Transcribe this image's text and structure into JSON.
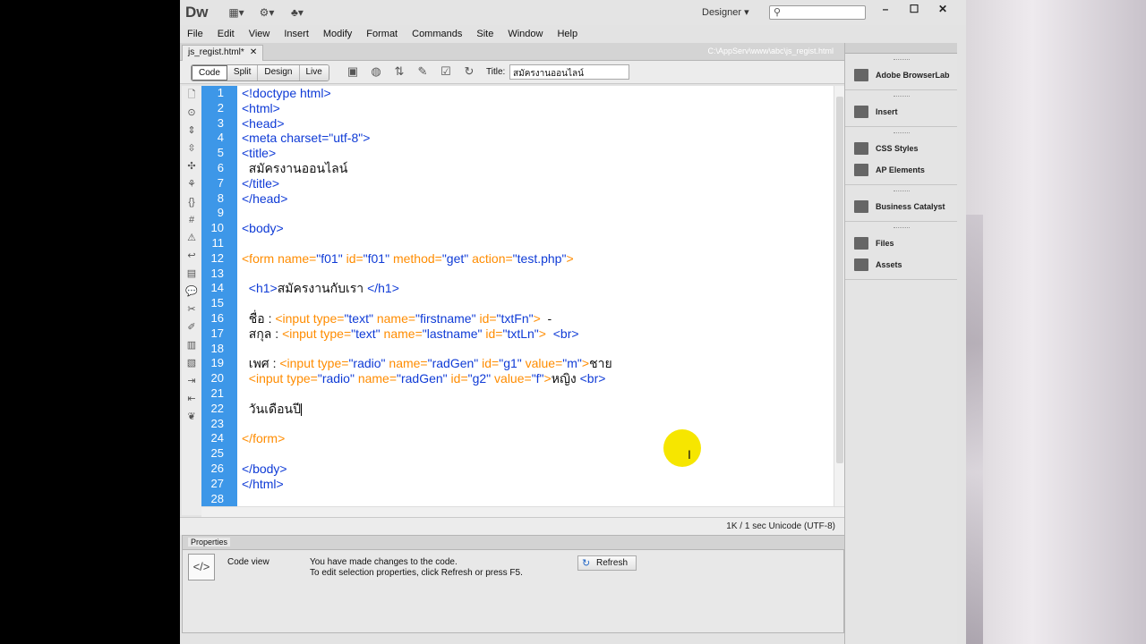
{
  "app": {
    "logo": "Dw",
    "workspace": "Designer",
    "window_buttons": [
      "–",
      "☐",
      "✕"
    ]
  },
  "menu": [
    "File",
    "Edit",
    "View",
    "Insert",
    "Modify",
    "Format",
    "Commands",
    "Site",
    "Window",
    "Help"
  ],
  "document": {
    "tab_name": "js_regist.html*",
    "path": "C:\\AppServ\\www\\abc\\js_regist.html"
  },
  "view_buttons": [
    "Code",
    "Split",
    "Design",
    "Live"
  ],
  "title_label": "Title:",
  "title_value": "สมัครงานออนไลน์",
  "code_lines": [
    [
      {
        "t": "<!doctype html>",
        "c": "tag"
      }
    ],
    [
      {
        "t": "<html>",
        "c": "tag"
      }
    ],
    [
      {
        "t": "<head>",
        "c": "tag"
      }
    ],
    [
      {
        "t": "<meta charset=\"utf-8\">",
        "c": "tag"
      }
    ],
    [
      {
        "t": "<title>",
        "c": "tag"
      }
    ],
    [
      {
        "t": "  สมัครงานออนไลน์",
        "c": "txt"
      }
    ],
    [
      {
        "t": "</title>",
        "c": "tag"
      }
    ],
    [
      {
        "t": "</head>",
        "c": "tag"
      }
    ],
    [],
    [
      {
        "t": "<body>",
        "c": "tag"
      }
    ],
    [],
    [
      {
        "t": "<form ",
        "c": "form"
      },
      {
        "t": "name=",
        "c": "attr"
      },
      {
        "t": "\"f01\" ",
        "c": "val"
      },
      {
        "t": "id=",
        "c": "attr"
      },
      {
        "t": "\"f01\" ",
        "c": "val"
      },
      {
        "t": "method=",
        "c": "attr"
      },
      {
        "t": "\"get\" ",
        "c": "val"
      },
      {
        "t": "action=",
        "c": "attr"
      },
      {
        "t": "\"test.php\"",
        "c": "val"
      },
      {
        "t": ">",
        "c": "form"
      }
    ],
    [],
    [
      {
        "t": "  <h1>",
        "c": "tag"
      },
      {
        "t": "สมัครงานกับเรา ",
        "c": "txt"
      },
      {
        "t": "</h1>",
        "c": "tag"
      }
    ],
    [],
    [
      {
        "t": "  ชื่อ : ",
        "c": "txt"
      },
      {
        "t": "<input ",
        "c": "form"
      },
      {
        "t": "type=",
        "c": "attr"
      },
      {
        "t": "\"text\" ",
        "c": "val"
      },
      {
        "t": "name=",
        "c": "attr"
      },
      {
        "t": "\"firstname\" ",
        "c": "val"
      },
      {
        "t": "id=",
        "c": "attr"
      },
      {
        "t": "\"txtFn\"",
        "c": "val"
      },
      {
        "t": "> ",
        "c": "form"
      },
      {
        "t": " -",
        "c": "txt"
      }
    ],
    [
      {
        "t": "  สกุล : ",
        "c": "txt"
      },
      {
        "t": "<input ",
        "c": "form"
      },
      {
        "t": "type=",
        "c": "attr"
      },
      {
        "t": "\"text\" ",
        "c": "val"
      },
      {
        "t": "name=",
        "c": "attr"
      },
      {
        "t": "\"lastname\" ",
        "c": "val"
      },
      {
        "t": "id=",
        "c": "attr"
      },
      {
        "t": "\"txtLn\"",
        "c": "val"
      },
      {
        "t": "> ",
        "c": "form"
      },
      {
        "t": " <br>",
        "c": "tag"
      }
    ],
    [],
    [
      {
        "t": "  เพศ : ",
        "c": "txt"
      },
      {
        "t": "<input ",
        "c": "form"
      },
      {
        "t": "type=",
        "c": "attr"
      },
      {
        "t": "\"radio\" ",
        "c": "val"
      },
      {
        "t": "name=",
        "c": "attr"
      },
      {
        "t": "\"radGen\" ",
        "c": "val"
      },
      {
        "t": "id=",
        "c": "attr"
      },
      {
        "t": "\"g1\" ",
        "c": "val"
      },
      {
        "t": "value=",
        "c": "attr"
      },
      {
        "t": "\"m\"",
        "c": "val"
      },
      {
        "t": ">",
        "c": "form"
      },
      {
        "t": "ชาย",
        "c": "txt"
      }
    ],
    [
      {
        "t": "  <input ",
        "c": "form"
      },
      {
        "t": "type=",
        "c": "attr"
      },
      {
        "t": "\"radio\" ",
        "c": "val"
      },
      {
        "t": "name=",
        "c": "attr"
      },
      {
        "t": "\"radGen\" ",
        "c": "val"
      },
      {
        "t": "id=",
        "c": "attr"
      },
      {
        "t": "\"g2\" ",
        "c": "val"
      },
      {
        "t": "value=",
        "c": "attr"
      },
      {
        "t": "\"f\"",
        "c": "val"
      },
      {
        "t": ">",
        "c": "form"
      },
      {
        "t": "หญิง ",
        "c": "txt"
      },
      {
        "t": "<br>",
        "c": "tag"
      }
    ],
    [],
    [
      {
        "t": "  วันเดือนปี",
        "c": "txt"
      }
    ],
    [],
    [
      {
        "t": "</form>",
        "c": "form"
      }
    ],
    [],
    [
      {
        "t": "</body>",
        "c": "tag"
      }
    ],
    [
      {
        "t": "</html>",
        "c": "tag"
      }
    ],
    []
  ],
  "status": "1K / 1 sec  Unicode (UTF-8)",
  "properties": {
    "tab": "Properties",
    "mode": "Code view",
    "message1": "You have made changes to the code.",
    "message2": "To edit selection properties, click Refresh or press F5.",
    "refresh": "Refresh"
  },
  "panels": [
    [
      "Adobe BrowserLab"
    ],
    [
      "Insert"
    ],
    [
      "CSS Styles",
      "AP Elements"
    ],
    [
      "Business Catalyst"
    ],
    [
      "Files",
      "Assets"
    ]
  ],
  "colors": {
    "gutter": "#3d97e8",
    "tag": "#0f3bd6",
    "form_tag": "#ff8c00"
  }
}
